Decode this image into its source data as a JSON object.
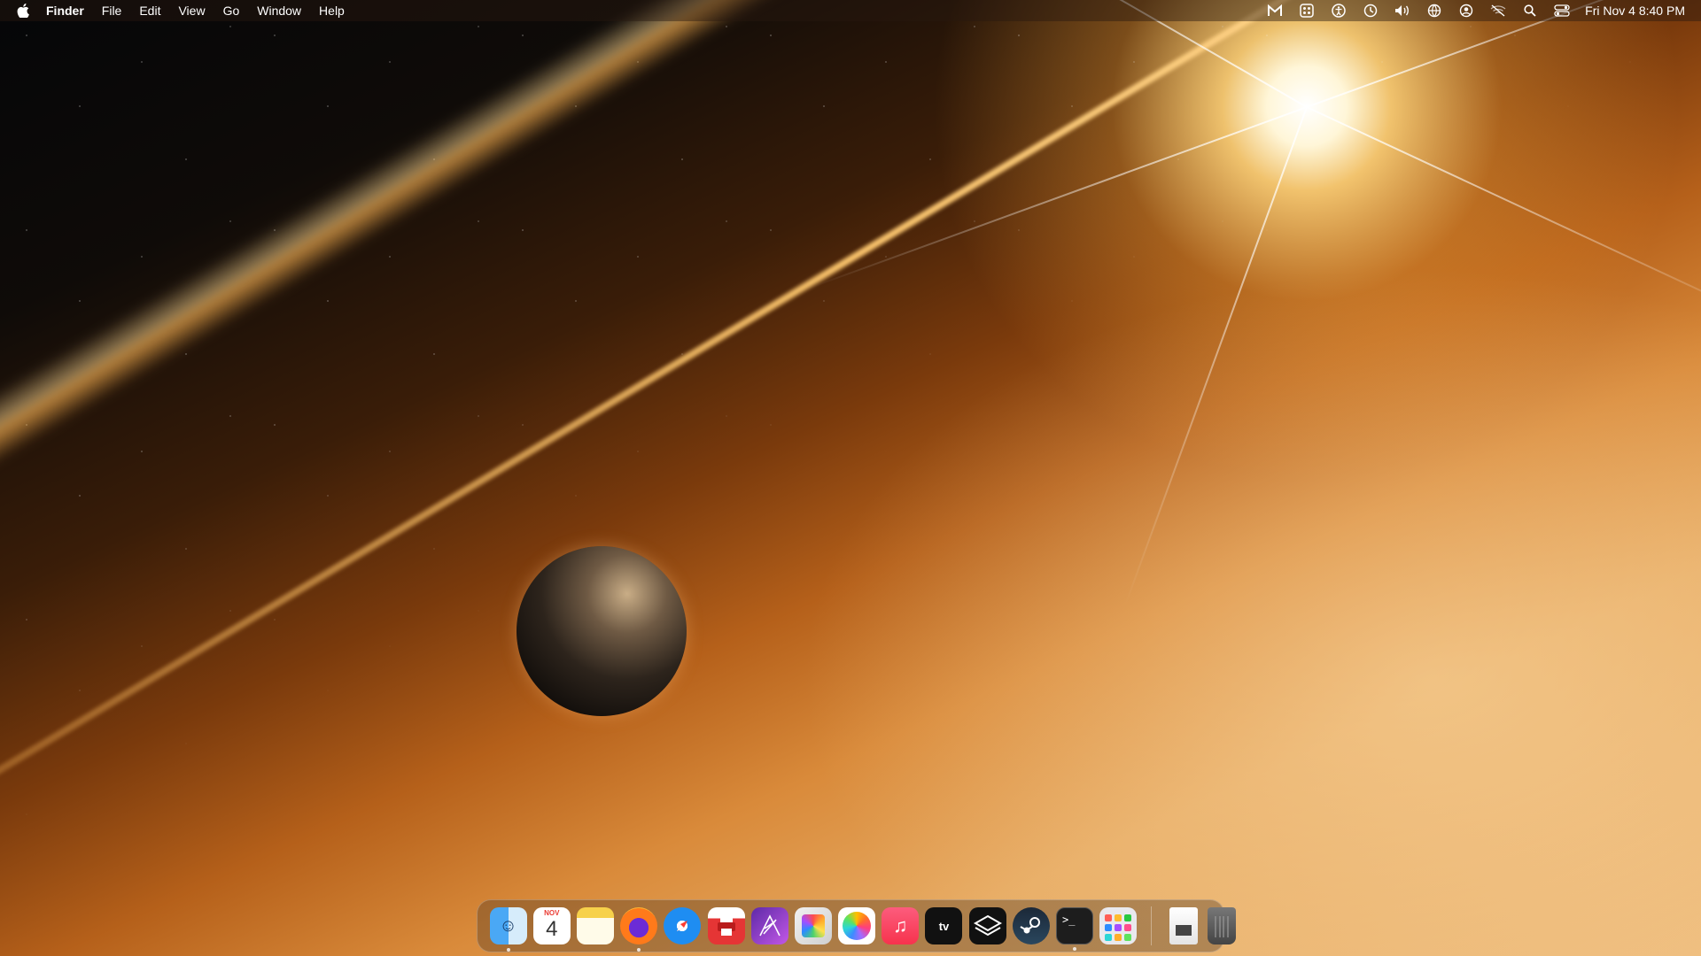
{
  "menubar": {
    "apple_icon": "apple-icon",
    "items": [
      "Finder",
      "File",
      "Edit",
      "View",
      "Go",
      "Window",
      "Help"
    ],
    "status_icons": [
      "gmail-icon",
      "app-grid-icon",
      "accessibility-icon",
      "time-machine-icon",
      "volume-icon",
      "vpn-icon",
      "user-icon",
      "wifi-off-icon",
      "spotlight-icon",
      "control-center-icon"
    ],
    "clock": "Fri Nov 4  8:40 PM"
  },
  "dock": {
    "apps": [
      {
        "name": "finder",
        "running": true
      },
      {
        "name": "calendar",
        "running": false,
        "month": "NOV",
        "day": "4"
      },
      {
        "name": "notes",
        "running": false
      },
      {
        "name": "firefox",
        "running": true
      },
      {
        "name": "safari",
        "running": false
      },
      {
        "name": "printer",
        "running": false
      },
      {
        "name": "affinity-designer",
        "running": false
      },
      {
        "name": "pixelmator",
        "running": false
      },
      {
        "name": "photos",
        "running": false
      },
      {
        "name": "music",
        "running": false
      },
      {
        "name": "apple-tv",
        "running": false,
        "label": "tv"
      },
      {
        "name": "sketch",
        "running": false
      },
      {
        "name": "steam",
        "running": false
      },
      {
        "name": "terminal",
        "running": true,
        "label": ">_"
      },
      {
        "name": "launchpad",
        "running": false
      }
    ],
    "trailing": [
      "document",
      "trash"
    ]
  },
  "colors": {
    "menubar_bg": "#28190f",
    "calendar_red": "#ea3b33",
    "running_dot": "#ffffff"
  }
}
